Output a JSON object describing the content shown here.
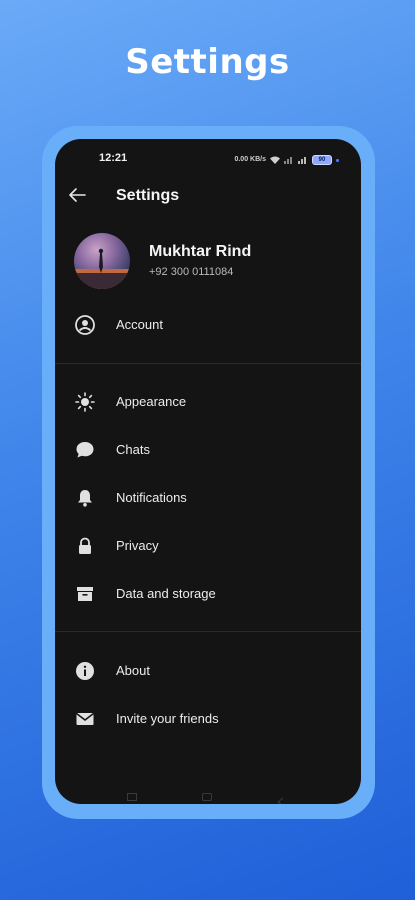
{
  "promo": {
    "title": "Settings"
  },
  "status_bar": {
    "time": "12:21",
    "network": "0.00 KB/s",
    "battery": "90"
  },
  "app_bar": {
    "title": "Settings"
  },
  "profile": {
    "name": "Mukhtar Rind",
    "phone": "+92 300 0111084"
  },
  "menu": {
    "account": "Account",
    "appearance": "Appearance",
    "chats": "Chats",
    "notifications": "Notifications",
    "privacy": "Privacy",
    "data_storage": "Data and storage",
    "about": "About",
    "invite": "Invite your friends"
  },
  "colors": {
    "background_gradient_top": "#6aaaf7",
    "background_gradient_bottom": "#1f5fd8",
    "device_frame": "#69aef8",
    "screen": "#141414",
    "text_primary": "#f5f5f5"
  },
  "icons": [
    "back-arrow-icon",
    "account-circle-icon",
    "sun-icon",
    "chat-bubble-icon",
    "bell-icon",
    "lock-icon",
    "archive-box-icon",
    "info-icon",
    "envelope-icon"
  ]
}
